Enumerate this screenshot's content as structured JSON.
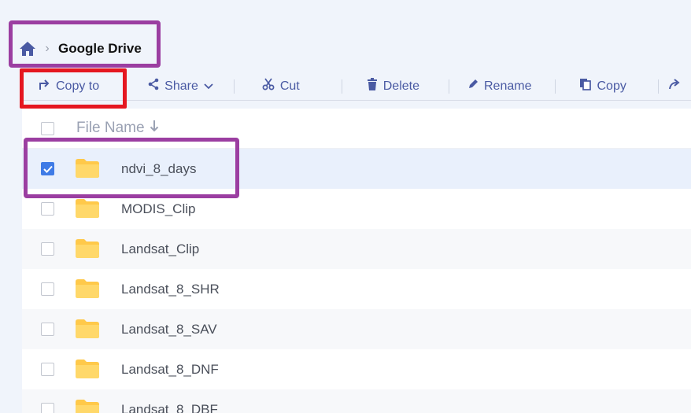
{
  "breadcrumb": {
    "home_icon": "home-icon",
    "separator_icon": "chevron-right-icon",
    "current": "Google Drive"
  },
  "toolbar": {
    "items": [
      {
        "label": "Copy to",
        "icon": "copy-to-arrow-icon"
      },
      {
        "label": "Share",
        "icon": "share-icon"
      },
      {
        "label": "Cut",
        "icon": "scissors-icon"
      },
      {
        "label": "Delete",
        "icon": "trash-icon"
      },
      {
        "label": "Rename",
        "icon": "pencil-icon"
      },
      {
        "label": "Copy",
        "icon": "copy-icon"
      }
    ]
  },
  "list": {
    "header": {
      "label": "File Name",
      "sort": "descending"
    },
    "rows": [
      {
        "name": "ndvi_8_days",
        "checked": true
      },
      {
        "name": "MODIS_Clip",
        "checked": false
      },
      {
        "name": "Landsat_Clip",
        "checked": false
      },
      {
        "name": "Landsat_8_SHR",
        "checked": false
      },
      {
        "name": "Landsat_8_SAV",
        "checked": false
      },
      {
        "name": "Landsat_8_DNF",
        "checked": false
      },
      {
        "name": "Landsat_8_DBF",
        "checked": false
      }
    ]
  },
  "colors": {
    "accent": "#4a5aa3",
    "checkbox_checked": "#3f7be6",
    "folder": "#ffc94a",
    "highlight_purple": "#9b3ea1",
    "highlight_red": "#e51720"
  }
}
